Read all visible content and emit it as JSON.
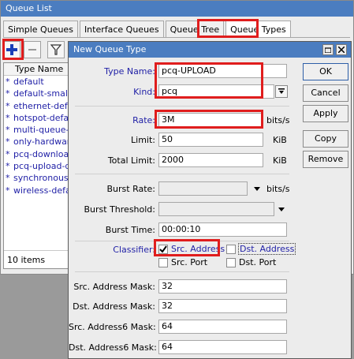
{
  "outer": {
    "title": "Queue List",
    "tabs": [
      "Simple Queues",
      "Interface Queues",
      "Queue Tree",
      "Queue Types"
    ],
    "list_header": "Type Name",
    "items": [
      "default",
      "default-small",
      "ethernet-default",
      "hotspot-default",
      "multi-queue-ethernet-default",
      "only-hardware-queue",
      "pcq-download-default",
      "pcq-upload-default",
      "synchronous-default",
      "wireless-default"
    ],
    "footer": "10 items"
  },
  "dialog": {
    "title": "New Queue Type",
    "type_name_label": "Type Name:",
    "type_name_value": "pcq-UPLOAD",
    "kind_label": "Kind:",
    "kind_value": "pcq",
    "rate_label": "Rate:",
    "rate_value": "3M",
    "rate_unit": "bits/s",
    "limit_label": "Limit:",
    "limit_value": "50",
    "limit_unit": "KiB",
    "total_limit_label": "Total Limit:",
    "total_limit_value": "2000",
    "total_limit_unit": "KiB",
    "burst_rate_label": "Burst Rate:",
    "burst_rate_unit": "bits/s",
    "burst_threshold_label": "Burst Threshold:",
    "burst_time_label": "Burst Time:",
    "burst_time_value": "00:00:10",
    "classifier_label": "Classifier:",
    "src_address": "Src. Address",
    "dst_address": "Dst. Address",
    "src_port": "Src. Port",
    "dst_port": "Dst. Port",
    "src_mask_label": "Src. Address Mask:",
    "src_mask_value": "32",
    "dst_mask_label": "Dst. Address Mask:",
    "dst_mask_value": "32",
    "src6_mask_label": "Src. Address6 Mask:",
    "src6_mask_value": "64",
    "dst6_mask_label": "Dst. Address6 Mask:",
    "dst6_mask_value": "64",
    "buttons": {
      "ok": "OK",
      "cancel": "Cancel",
      "apply": "Apply",
      "copy": "Copy",
      "remove": "Remove"
    }
  },
  "colors": {
    "title_bar": "#4b7dc0",
    "highlight": "#e01d1d",
    "label_blue": "#1f1fa6"
  },
  "icons": [
    "plus-icon",
    "minus-icon",
    "filter-icon",
    "minimize-icon",
    "close-icon",
    "dropdown-icon",
    "checkmark-icon"
  ]
}
